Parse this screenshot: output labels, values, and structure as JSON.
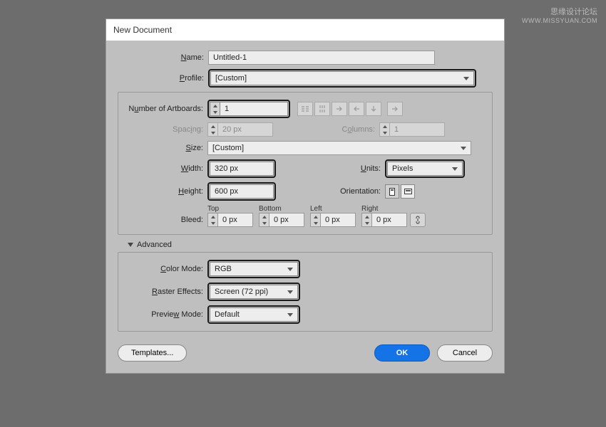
{
  "watermark": {
    "line1": "思缘设计论坛",
    "line2": "WWW.MISSYUAN.COM"
  },
  "dialog": {
    "title": "New Document",
    "labels": {
      "name": "Name:",
      "profile": "Profile:",
      "artboards": "Number of Artboards:",
      "spacing": "Spacing:",
      "columns": "Columns:",
      "size": "Size:",
      "width": "Width:",
      "height": "Height:",
      "units": "Units:",
      "orientation": "Orientation:",
      "bleed": "Bleed:",
      "bleed_top": "Top",
      "bleed_bottom": "Bottom",
      "bleed_left": "Left",
      "bleed_right": "Right",
      "advanced": "Advanced",
      "color_mode": "Color Mode:",
      "raster": "Raster Effects:",
      "preview": "Preview Mode:"
    },
    "values": {
      "name": "Untitled-1",
      "profile": "[Custom]",
      "artboards": "1",
      "spacing": "20 px",
      "columns": "1",
      "size": "[Custom]",
      "width": "320 px",
      "height": "600 px",
      "units": "Pixels",
      "bleed_top": "0 px",
      "bleed_bottom": "0 px",
      "bleed_left": "0 px",
      "bleed_right": "0 px",
      "color_mode": "RGB",
      "raster": "Screen (72 ppi)",
      "preview": "Default"
    },
    "buttons": {
      "templates": "Templates...",
      "ok": "OK",
      "cancel": "Cancel"
    }
  }
}
